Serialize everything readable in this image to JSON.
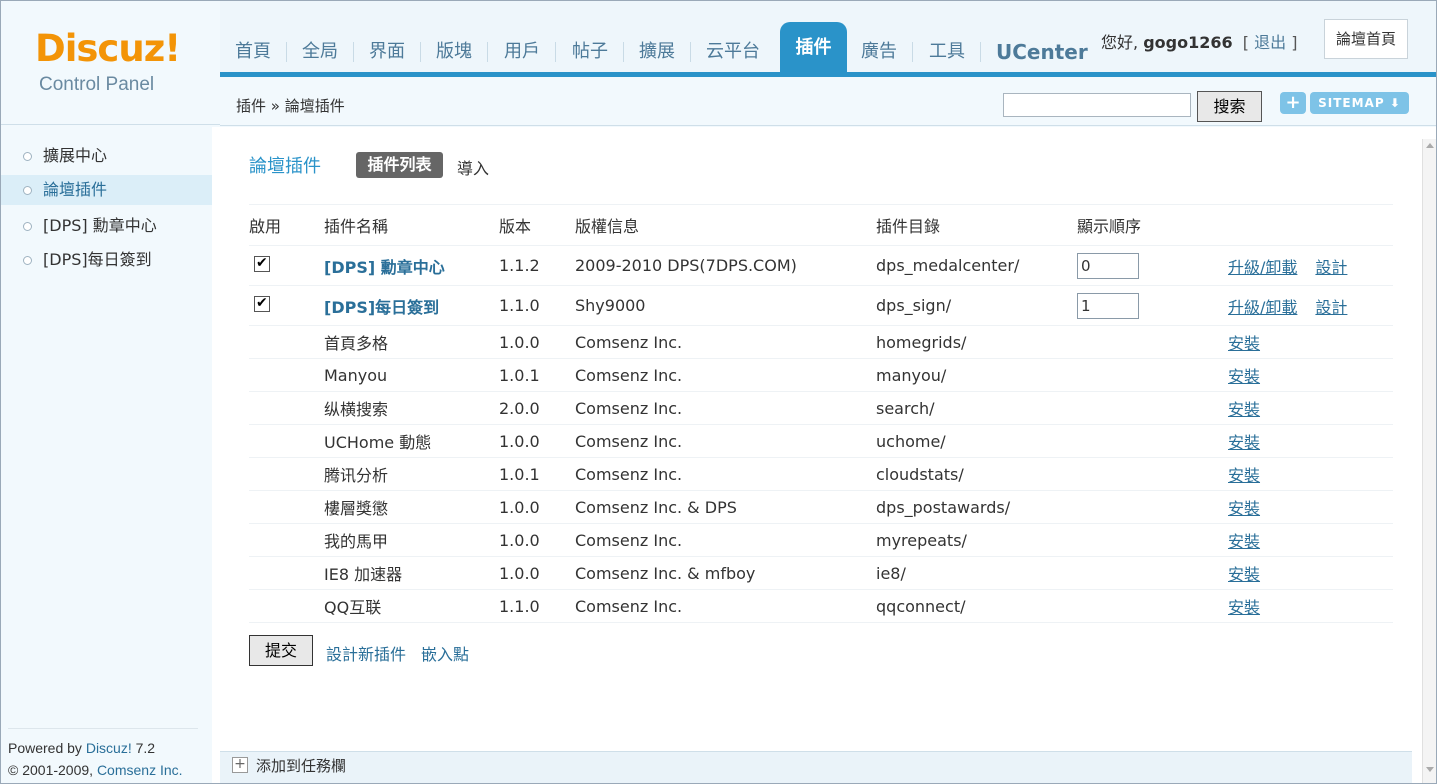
{
  "logo": {
    "main": "Discuz!",
    "sub": "Control Panel"
  },
  "nav": {
    "items": [
      "首頁",
      "全局",
      "界面",
      "版塊",
      "用戶",
      "帖子",
      "擴展",
      "云平台"
    ],
    "active": "插件",
    "after": [
      "廣告",
      "工具"
    ],
    "ucenter": "UCenter"
  },
  "user": {
    "greeting": "您好,",
    "name": "gogo1266",
    "bracket_open": "[",
    "logout": "退出",
    "bracket_close": "]"
  },
  "home_button": "論壇首頁",
  "subbar": {
    "breadcrumb": "插件 » 論壇插件",
    "search_label": "搜索",
    "plus": "+",
    "sitemap": "SITEMAP ⬇"
  },
  "sidebar": {
    "items": [
      "擴展中心",
      "論壇插件",
      "[DPS] 勳章中心",
      "[DPS]每日簽到"
    ],
    "footer": {
      "powered": "Powered by ",
      "discuz": "Discuz!",
      "version": " 7.2",
      "copy": "© 2001-2009, ",
      "comsenz": "Comsenz Inc."
    }
  },
  "main": {
    "title": "論壇插件",
    "tab_list": "插件列表",
    "tab_import": "導入",
    "headers": [
      "啟用",
      "插件名稱",
      "版本",
      "版權信息",
      "插件目錄",
      "顯示順序",
      ""
    ],
    "enabled_rows": [
      {
        "name_en": "[DPS]",
        "name_zh": " 勳章中心",
        "version": "1.1.2",
        "copyright": "2009-2010 DPS(7DPS.COM)",
        "dir": "dps_medalcenter/",
        "order": "0",
        "act1": "升級/卸載",
        "act2": "設計"
      },
      {
        "name_en": "[DPS]",
        "name_zh": "每日簽到",
        "version": "1.1.0",
        "copyright": "Shy9000",
        "dir": "dps_sign/",
        "order": "1",
        "act1": "升級/卸載",
        "act2": "設計"
      }
    ],
    "rows": [
      {
        "name": "首頁多格",
        "version": "1.0.0",
        "copyright": "Comsenz Inc.",
        "dir": "homegrids/",
        "act": "安裝"
      },
      {
        "name": "Manyou",
        "version": "1.0.1",
        "copyright": "Comsenz Inc.",
        "dir": "manyou/",
        "act": "安裝"
      },
      {
        "name": "纵横搜索",
        "version": "2.0.0",
        "copyright": "Comsenz Inc.",
        "dir": "search/",
        "act": "安裝"
      },
      {
        "name": "UCHome 動態",
        "version": "1.0.0",
        "copyright": "Comsenz Inc.",
        "dir": "uchome/",
        "act": "安裝"
      },
      {
        "name": "腾讯分析",
        "version": "1.0.1",
        "copyright": "Comsenz Inc.",
        "dir": "cloudstats/",
        "act": "安裝"
      },
      {
        "name": "樓層獎懲",
        "version": "1.0.0",
        "copyright": "Comsenz Inc. & DPS",
        "dir": "dps_postawards/",
        "act": "安裝"
      },
      {
        "name": "我的馬甲",
        "version": "1.0.0",
        "copyright": "Comsenz Inc.",
        "dir": "myrepeats/",
        "act": "安裝"
      },
      {
        "name": "IE8 加速器",
        "version": "1.0.0",
        "copyright": "Comsenz Inc. & mfboy",
        "dir": "ie8/",
        "act": "安裝"
      },
      {
        "name": "QQ互联",
        "version": "1.1.0",
        "copyright": "Comsenz Inc.",
        "dir": "qqconnect/",
        "act": "安裝"
      }
    ],
    "submit": "提交",
    "link_design": "設計新插件",
    "link_hook": "嵌入點"
  },
  "taskbar": {
    "icon": "+",
    "text": "添加到任務欄"
  },
  "icons": {
    "checkbox": "check-icon",
    "bullet": "circle-bullet-icon",
    "plus": "plus-icon",
    "add_task": "plus-square-icon"
  },
  "colors": {
    "accent": "#2a93c9",
    "logo": "#f39407",
    "link": "#2a6f99"
  }
}
